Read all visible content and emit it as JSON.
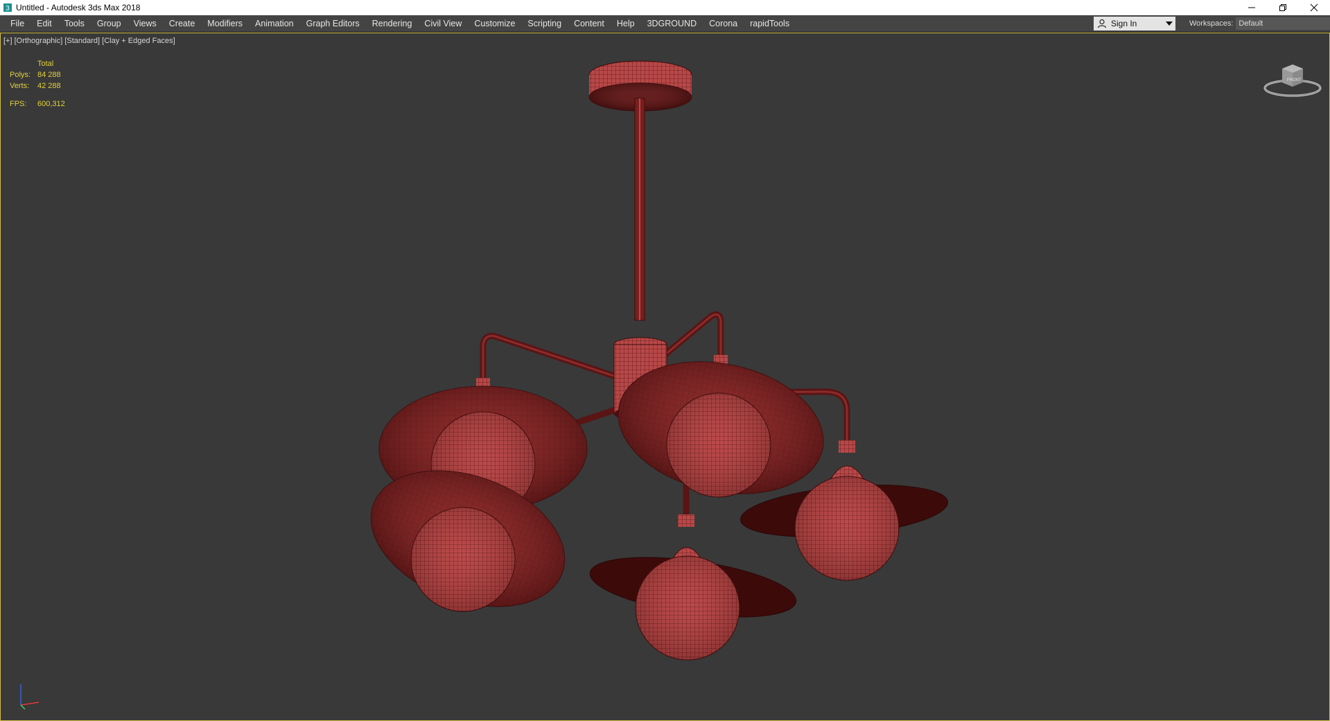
{
  "window": {
    "title": "Untitled - Autodesk 3ds Max 2018"
  },
  "menubar": {
    "items": [
      "File",
      "Edit",
      "Tools",
      "Group",
      "Views",
      "Create",
      "Modifiers",
      "Animation",
      "Graph Editors",
      "Rendering",
      "Civil View",
      "Customize",
      "Scripting",
      "Content",
      "Help",
      "3DGROUND",
      "Corona",
      "rapidTools"
    ],
    "sign_in": "Sign In",
    "workspaces_label": "Workspaces:",
    "workspace_value": "Default"
  },
  "viewport": {
    "label": "[+] [Orthographic] [Standard] [Clay + Edged Faces]",
    "stats": {
      "total_label": "Total",
      "polys_label": "Polys:",
      "polys_value": "84 288",
      "verts_label": "Verts:",
      "verts_value": "42 288",
      "fps_label": "FPS:",
      "fps_value": "600,312"
    },
    "viewcube_label": "FRONT",
    "colors": {
      "background": "#393939",
      "model_fill": "#b84848",
      "model_dark": "#3d0c0c",
      "border": "#d6c244",
      "stats_text": "#e2d13a"
    }
  }
}
